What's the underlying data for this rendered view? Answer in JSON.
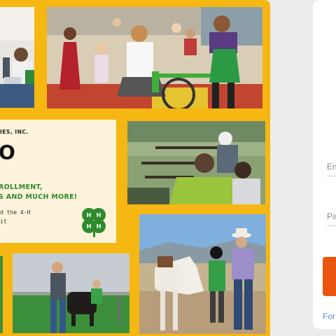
{
  "promo_card": {
    "org_name": "IES, INC.",
    "headline": "O",
    "promo_line1": "ROLLMENT,",
    "promo_line2": "S AND MUCH MORE!",
    "body_line1": "d the 4-H",
    "body_line2": "it"
  },
  "login": {
    "email_label": "Em",
    "password_label": "Pa",
    "forgot_link": "For"
  },
  "colors": {
    "frame": "#f6b712",
    "card_background": "#fdf3da",
    "accent_green": "#2e8b2e",
    "submit_button": "#e8550f",
    "link": "#4a90d9"
  },
  "icons": [
    "four-h-clover-icon"
  ]
}
